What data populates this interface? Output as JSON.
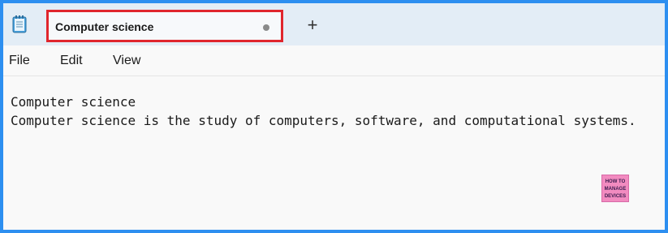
{
  "tabs": [
    {
      "title": "Computer science",
      "modified": true
    }
  ],
  "new_tab_label": "+",
  "menu": {
    "items": [
      "File",
      "Edit",
      "View"
    ]
  },
  "document": {
    "lines": [
      "Computer science",
      "Computer science is the study of computers, software, and computational systems."
    ]
  },
  "watermark": {
    "lines": [
      "HOW TO",
      "MANAGE",
      "DEVICES"
    ]
  },
  "colors": {
    "frame_border": "#2d8ff0",
    "tab_highlight": "#e0262d",
    "tabbar_bg": "#e3edf6",
    "editor_bg": "#f9f9f9",
    "watermark_bg": "#f28bc0"
  },
  "icons": {
    "app": "notepad-icon",
    "new_tab": "plus-icon",
    "unsaved": "unsaved-dot-icon"
  }
}
